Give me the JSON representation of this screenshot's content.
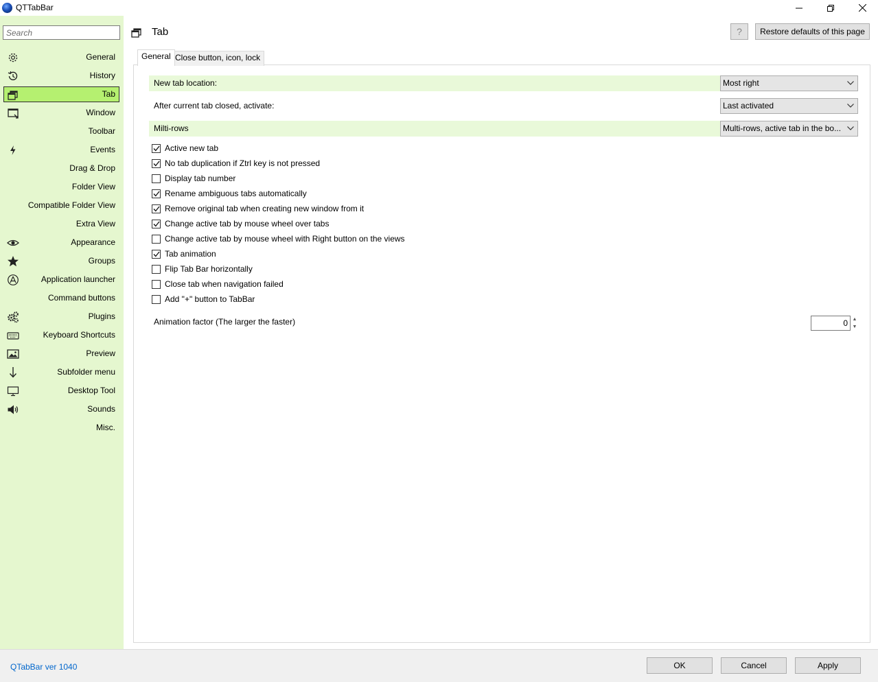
{
  "window": {
    "title": "QTTabBar",
    "minimize_glyph": "—",
    "maximize_glyph": "❐",
    "close_glyph": "✕"
  },
  "sidebar": {
    "search_placeholder": "Search",
    "items": [
      {
        "label": "General",
        "icon": "gear-icon"
      },
      {
        "label": "History",
        "icon": "history-icon"
      },
      {
        "label": "Tab",
        "icon": "tab-windows-icon",
        "selected": true
      },
      {
        "label": "Window",
        "icon": "window-icon"
      },
      {
        "label": "Toolbar",
        "icon": ""
      },
      {
        "label": "Events",
        "icon": "lightning-icon"
      },
      {
        "label": "Drag & Drop",
        "icon": ""
      },
      {
        "label": "Folder View",
        "icon": ""
      },
      {
        "label": "Compatible Folder View",
        "icon": ""
      },
      {
        "label": "Extra View",
        "icon": ""
      },
      {
        "label": "Appearance",
        "icon": "eye-icon"
      },
      {
        "label": "Groups",
        "icon": "star-icon"
      },
      {
        "label": "Application launcher",
        "icon": "app-store-icon"
      },
      {
        "label": "Command buttons",
        "icon": ""
      },
      {
        "label": "Plugins",
        "icon": "gears-icon"
      },
      {
        "label": "Keyboard Shortcuts",
        "icon": "keyboard-icon"
      },
      {
        "label": "Preview",
        "icon": "image-icon"
      },
      {
        "label": "Subfolder menu",
        "icon": "down-arrow-icon"
      },
      {
        "label": "Desktop Tool",
        "icon": "monitor-icon"
      },
      {
        "label": "Sounds",
        "icon": "speaker-icon"
      },
      {
        "label": "Misc.",
        "icon": ""
      }
    ]
  },
  "header": {
    "title": "Tab",
    "help_label": "?",
    "restore_label": "Restore defaults of this page"
  },
  "tabs": [
    {
      "label": "General",
      "active": true
    },
    {
      "label": "Close button, icon, lock",
      "active": false
    }
  ],
  "settings": {
    "new_tab_location": {
      "label": "New tab location:",
      "value": "Most right"
    },
    "after_close": {
      "label": "After current tab closed, activate:",
      "value": "Last activated"
    },
    "multi_rows": {
      "label": "Milti-rows",
      "value": "Multi-rows, active tab in the bo..."
    }
  },
  "checkboxes": [
    {
      "label": "Active new tab",
      "checked": true
    },
    {
      "label": "No tab duplication if Ztrl key is not pressed",
      "checked": true
    },
    {
      "label": "Display tab number",
      "checked": false
    },
    {
      "label": "Rename ambiguous tabs automatically",
      "checked": true
    },
    {
      "label": "Remove original tab when creating new window from it",
      "checked": true
    },
    {
      "label": "Change active tab by mouse wheel over tabs",
      "checked": true
    },
    {
      "label": "Change active tab by mouse wheel with Right button on the views",
      "checked": false
    },
    {
      "label": "Tab animation",
      "checked": true
    },
    {
      "label": "Flip Tab Bar horizontally",
      "checked": false
    },
    {
      "label": "Close tab when navigation failed",
      "checked": false
    },
    {
      "label": "Add \"+\" button to TabBar",
      "checked": false
    }
  ],
  "animation": {
    "label": "Animation factor (The larger the faster)",
    "value": "0"
  },
  "footer": {
    "version": "QTabBar ver 1040",
    "ok_label": "OK",
    "cancel_label": "Cancel",
    "apply_label": "Apply"
  },
  "colors": {
    "sidebar_bg": "#e5f7cf",
    "selected_bg": "#b5f070",
    "band_bg": "#e9f9d9",
    "link": "#0066cc"
  }
}
